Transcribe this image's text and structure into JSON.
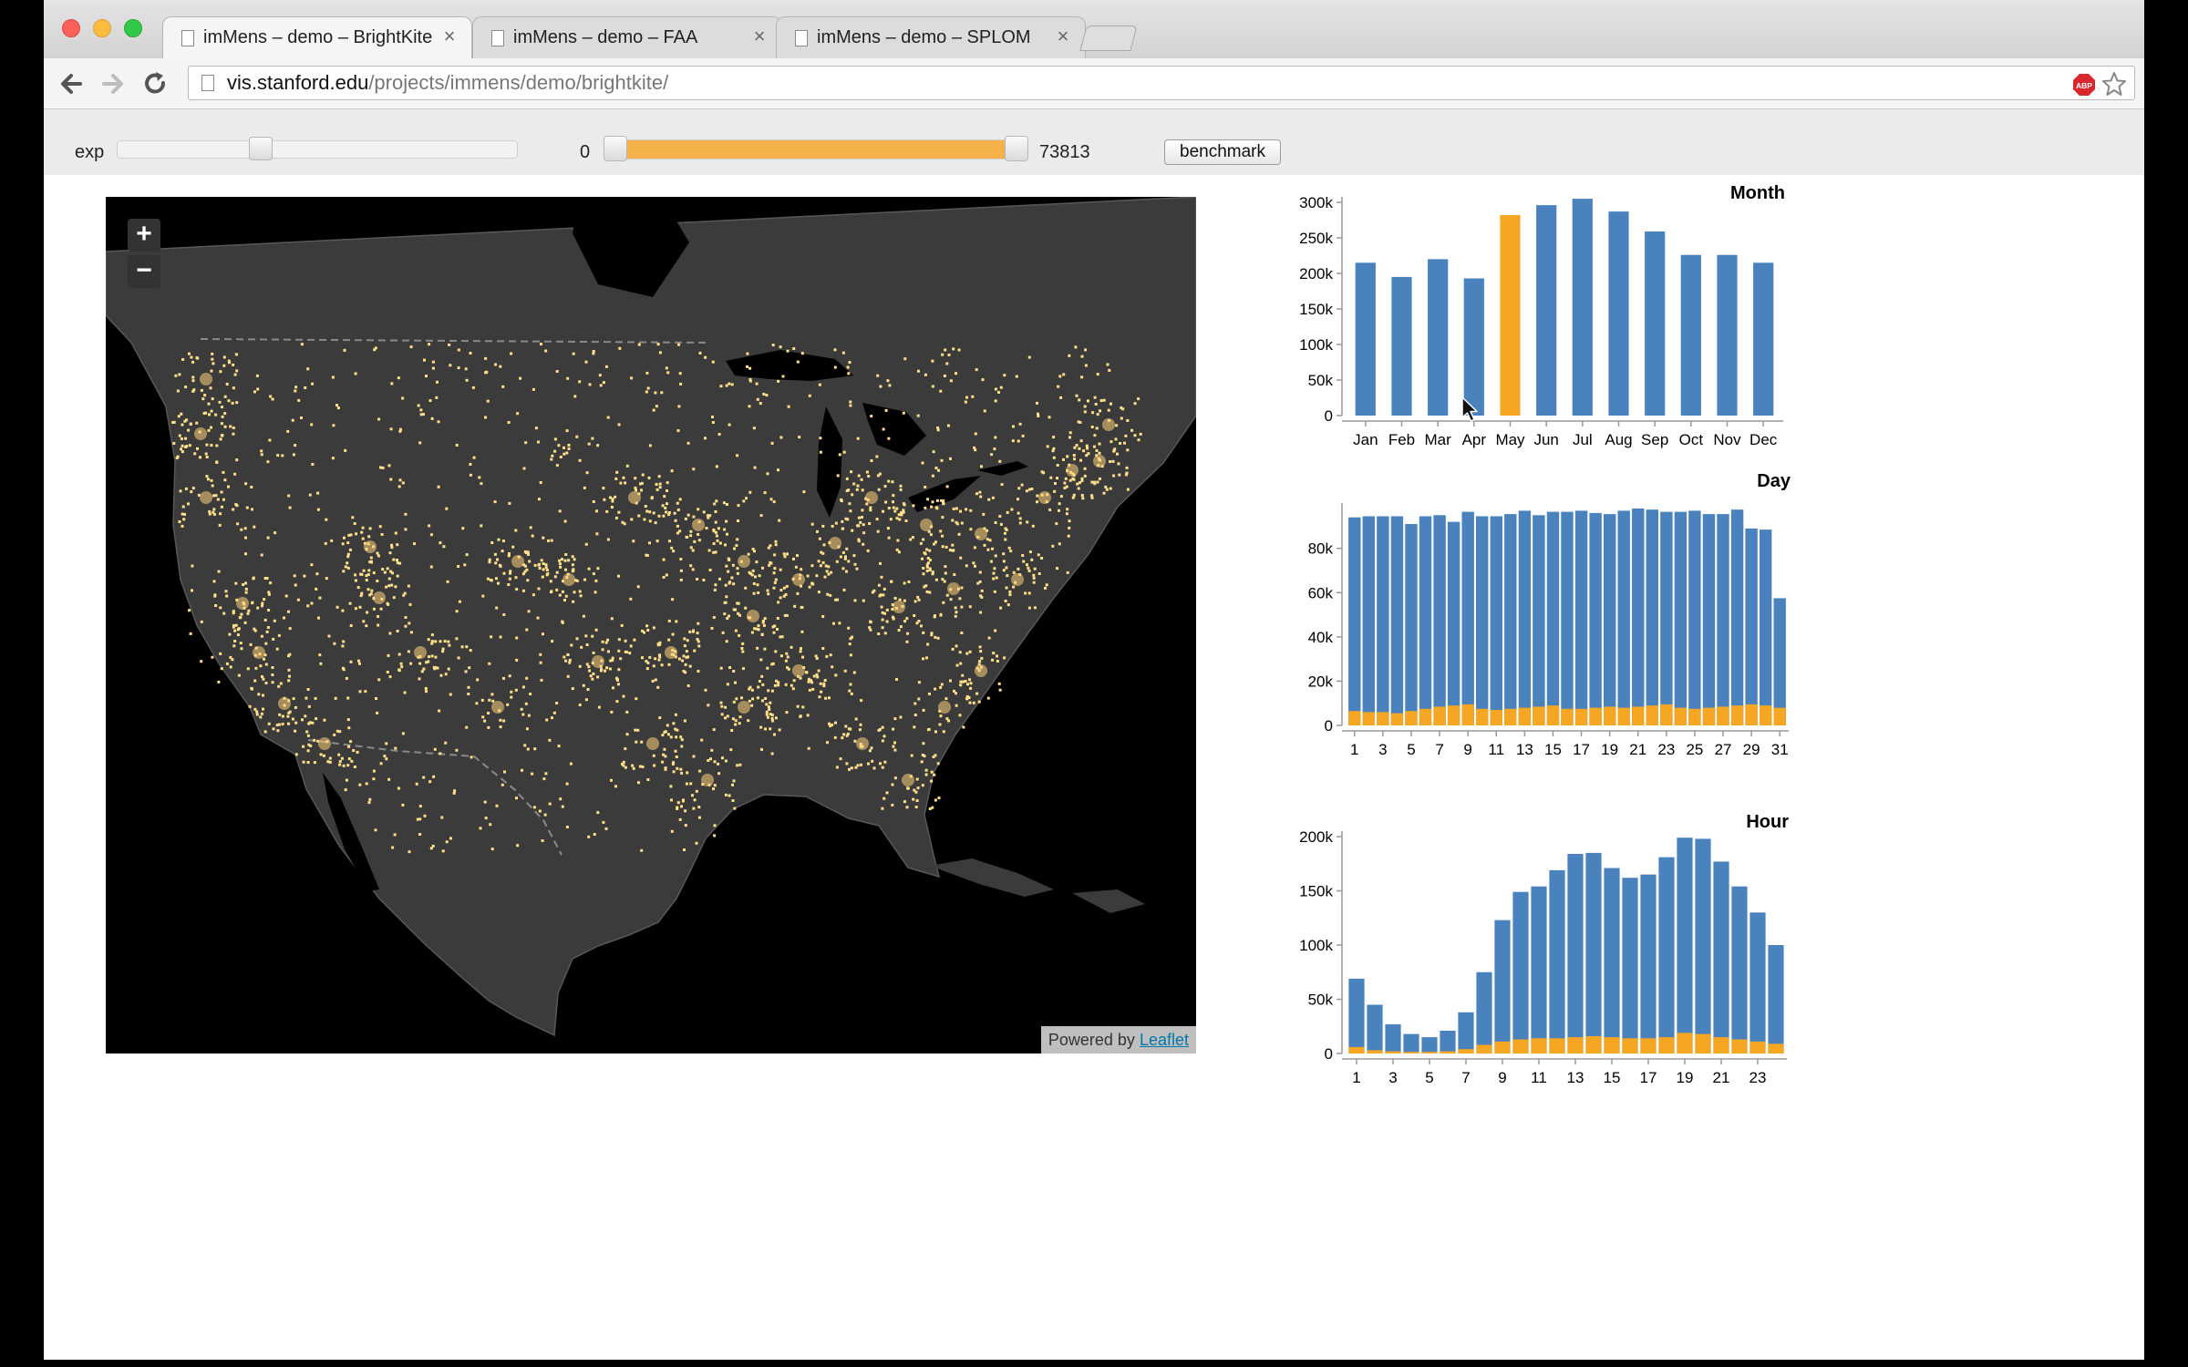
{
  "browser": {
    "tabs": [
      {
        "title": "imMens – demo – BrightKite",
        "active": true
      },
      {
        "title": "imMens – demo – FAA",
        "active": false
      },
      {
        "title": "imMens – demo – SPLOM",
        "active": false
      }
    ],
    "url_host": "vis.stanford.edu",
    "url_path": "/projects/immens/demo/brightkite/",
    "extension_badge": "ABP"
  },
  "controls": {
    "exp_label": "exp",
    "exp_value": 0.35,
    "range_min": "0",
    "range_max": "73813",
    "range_selected": [
      0,
      1
    ],
    "benchmark_label": "benchmark"
  },
  "map": {
    "zoom_in": "+",
    "zoom_out": "−",
    "attribution_prefix": "Powered by",
    "attribution_link": "Leaflet",
    "land_color": "#3b3b3b",
    "water_color": "#000000",
    "point_color": "#ffe08a"
  },
  "colors": {
    "bar_blue": "#4a82bd",
    "bar_orange": "#f5a623"
  },
  "chart_data": [
    {
      "type": "bar",
      "title": "Month",
      "categories": [
        "Jan",
        "Feb",
        "Mar",
        "Apr",
        "May",
        "Jun",
        "Jul",
        "Aug",
        "Sep",
        "Oct",
        "Nov",
        "Dec"
      ],
      "values": [
        215000,
        195000,
        220000,
        193000,
        282000,
        296000,
        305000,
        287000,
        259000,
        226000,
        226000,
        215000
      ],
      "highlighted": [
        "May"
      ],
      "ylim": [
        0,
        300000
      ],
      "yticks": [
        0,
        50000,
        100000,
        150000,
        200000,
        250000,
        300000
      ],
      "ytick_labels": [
        "0",
        "50k",
        "100k",
        "150k",
        "200k",
        "250k",
        "300k"
      ],
      "xtick_labels": [
        "Jan",
        "Feb",
        "Mar",
        "Apr",
        "May",
        "Jun",
        "Jul",
        "Aug",
        "Sep",
        "Oct",
        "Nov",
        "Dec"
      ]
    },
    {
      "type": "bar",
      "title": "Day",
      "categories": [
        1,
        2,
        3,
        4,
        5,
        6,
        7,
        8,
        9,
        10,
        11,
        12,
        13,
        14,
        15,
        16,
        17,
        18,
        19,
        20,
        21,
        22,
        23,
        24,
        25,
        26,
        27,
        28,
        29,
        30,
        31
      ],
      "series": [
        {
          "values": [
            94000,
            94500,
            94500,
            94500,
            91000,
            94500,
            95000,
            92000,
            96500,
            94500,
            94500,
            95500,
            97000,
            95000,
            96500,
            96500,
            97000,
            96000,
            95500,
            97000,
            98000,
            97500,
            96500,
            96500,
            97000,
            95500,
            95500,
            97500,
            89000,
            88500,
            57500
          ]
        },
        {
          "values": [
            6500,
            6000,
            6000,
            5500,
            6500,
            7500,
            8500,
            9000,
            9500,
            7500,
            7000,
            7500,
            8000,
            8500,
            9000,
            7500,
            7500,
            8000,
            8500,
            8000,
            8500,
            9000,
            9500,
            8000,
            7500,
            8000,
            8500,
            9000,
            9500,
            9000,
            8000
          ]
        }
      ],
      "ylim": [
        0,
        98000
      ],
      "yticks": [
        0,
        20000,
        40000,
        60000,
        80000
      ],
      "ytick_labels": [
        "0",
        "20k",
        "40k",
        "60k",
        "80k"
      ],
      "xtick_labels": [
        "1",
        "3",
        "5",
        "7",
        "9",
        "11",
        "13",
        "15",
        "17",
        "19",
        "21",
        "23",
        "25",
        "27",
        "29",
        "31"
      ]
    },
    {
      "type": "bar",
      "title": "Hour",
      "categories": [
        1,
        2,
        3,
        4,
        5,
        6,
        7,
        8,
        9,
        10,
        11,
        12,
        13,
        14,
        15,
        16,
        17,
        18,
        19,
        20,
        21,
        22,
        23,
        24
      ],
      "series": [
        {
          "values": [
            69000,
            45000,
            27000,
            18000,
            15000,
            21000,
            38000,
            75000,
            123000,
            149000,
            154000,
            169000,
            184000,
            185000,
            171000,
            162000,
            165000,
            181000,
            199000,
            198000,
            177000,
            154000,
            130000,
            100000
          ]
        },
        {
          "values": [
            6000,
            3000,
            2000,
            1500,
            1500,
            2000,
            4000,
            8000,
            11000,
            13000,
            14000,
            14000,
            15000,
            16000,
            15000,
            14000,
            14000,
            15000,
            19000,
            18000,
            15000,
            13000,
            11000,
            9000
          ]
        }
      ],
      "ylim": [
        0,
        200000
      ],
      "yticks": [
        0,
        50000,
        100000,
        150000,
        200000
      ],
      "ytick_labels": [
        "0",
        "50k",
        "100k",
        "150k",
        "200k"
      ],
      "xtick_labels": [
        "1",
        "3",
        "5",
        "7",
        "9",
        "11",
        "13",
        "15",
        "17",
        "19",
        "21",
        "23"
      ]
    }
  ]
}
